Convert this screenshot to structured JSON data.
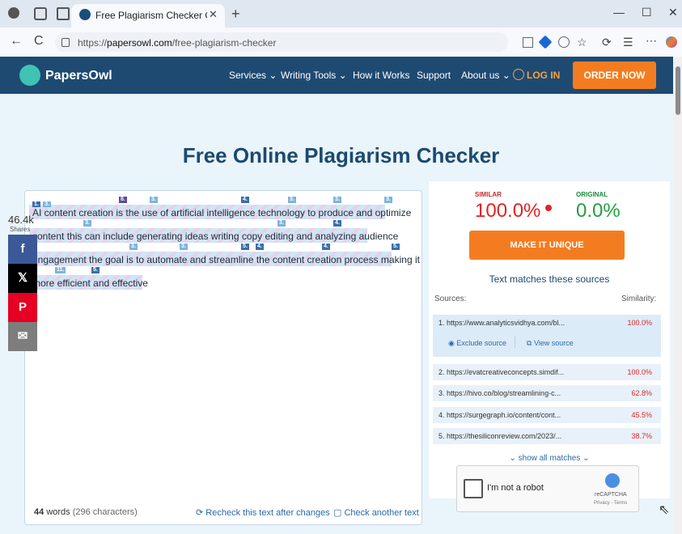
{
  "browser": {
    "tab_title": "Free Plagiarism Checker Online fo",
    "tab_close": "✕",
    "new_tab": "+",
    "url_prefix": "https://",
    "url_domain": "papersowl.com",
    "url_path": "/free-plagiarism-checker",
    "win_min": "—",
    "win_max": "☐",
    "win_close": "✕",
    "back": "←",
    "reload": "C"
  },
  "site": {
    "logo": "PapersOwl",
    "nav": [
      "Services ⌄",
      "Writing Tools ⌄",
      "How it Works",
      "Support",
      "About us ⌄"
    ],
    "login": "LOG IN",
    "order": "ORDER NOW"
  },
  "page": {
    "title": "Free Online Plagiarism Checker"
  },
  "editor": {
    "lines": [
      "AI content creation is the use of artificial intelligence technology to produce and optimize",
      "content this can include generating ideas writing copy editing and analyzing audience",
      "engagement the goal is to automate and streamline the content creation process making it",
      "more efficient and effective"
    ],
    "markers": [
      [
        "1.",
        "3.",
        "8.",
        "3.",
        "4.",
        "3.",
        "3.",
        "3."
      ],
      [
        "3.",
        "3.",
        "4."
      ],
      [
        "3.",
        "3.",
        "5.",
        "4.",
        "4.",
        "5."
      ],
      [
        "11.",
        "5."
      ]
    ],
    "words_count": "44",
    "words_label": "words",
    "chars": "(296 characters)",
    "recheck": "Recheck this text after changes",
    "check_another": "Check another text"
  },
  "share": {
    "count": "46.4k",
    "label": "Shares",
    "buttons": [
      "f",
      "𝕏",
      "P",
      "✉"
    ],
    "colors": [
      "#3b5998",
      "#000000",
      "#e60023",
      "#7d7d7d"
    ]
  },
  "results": {
    "similar_label": "SIMILAR",
    "similar_value": "100.0%",
    "original_label": "ORIGINAL",
    "original_value": "0.0%",
    "make_unique": "MAKE IT UNIQUE",
    "matches_heading": "Text matches these sources",
    "sources_label": "Sources:",
    "similarity_label": "Similarity:",
    "exclude": "Exclude source",
    "view_source": "View source",
    "show_all": "show all matches",
    "sources": [
      {
        "url": "1. https://www.analyticsvidhya.com/bl...",
        "pct": "100.0%"
      },
      {
        "url": "2. https://evatcreativeconcepts.simdif...",
        "pct": "100.0%"
      },
      {
        "url": "3. https://hivo.co/blog/streamlining-c...",
        "pct": "62.8%"
      },
      {
        "url": "4. https://surgegraph.io/content/cont...",
        "pct": "45.5%"
      },
      {
        "url": "5. https://thesiliconreview.com/2023/...",
        "pct": "38.7%"
      }
    ]
  },
  "recaptcha": {
    "text": "I'm not a robot",
    "label": "reCAPTCHA",
    "terms": "Privacy - Terms"
  }
}
